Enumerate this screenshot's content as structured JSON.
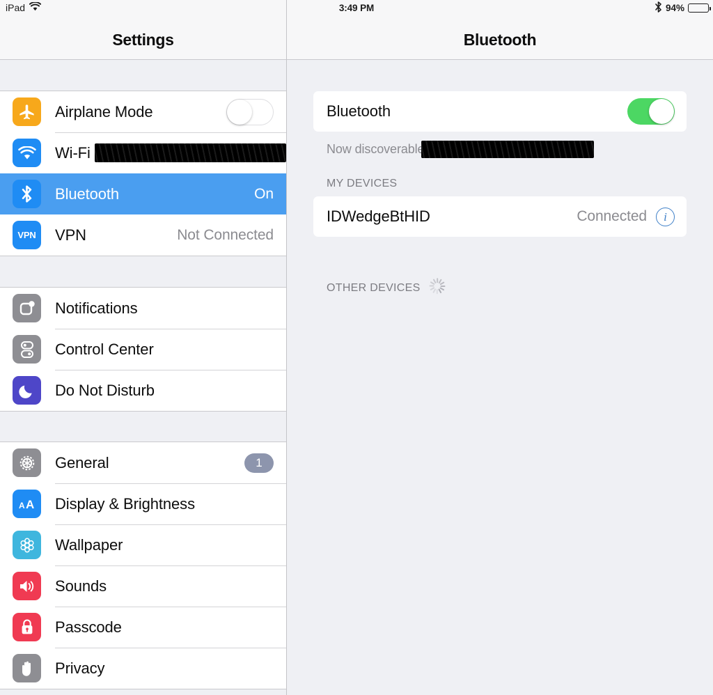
{
  "status_bar": {
    "device_label": "iPad",
    "wifi_icon": "wifi-icon",
    "time": "3:49 PM",
    "bluetooth_icon": "bluetooth-icon",
    "battery_percent": "94%",
    "battery_icon": "battery-full-icon"
  },
  "sidebar": {
    "title": "Settings",
    "groups": [
      {
        "items": [
          {
            "label": "Airplane Mode",
            "icon": "airplane-icon",
            "accessory": "toggle",
            "toggle_on": false,
            "value": ""
          },
          {
            "label": "Wi-Fi",
            "icon": "wifi-icon",
            "accessory": "redaction",
            "value": ""
          },
          {
            "label": "Bluetooth",
            "icon": "bluetooth-icon",
            "accessory": "value",
            "value": "On",
            "selected": true
          },
          {
            "label": "VPN",
            "icon": "vpn-icon",
            "accessory": "value",
            "value": "Not Connected"
          }
        ]
      },
      {
        "items": [
          {
            "label": "Notifications",
            "icon": "notifications-icon",
            "accessory": "none",
            "value": ""
          },
          {
            "label": "Control Center",
            "icon": "control-center-icon",
            "accessory": "none",
            "value": ""
          },
          {
            "label": "Do Not Disturb",
            "icon": "moon-icon",
            "accessory": "none",
            "value": ""
          }
        ]
      },
      {
        "items": [
          {
            "label": "General",
            "icon": "gear-icon",
            "accessory": "badge",
            "value": "1"
          },
          {
            "label": "Display & Brightness",
            "icon": "display-brightness-icon",
            "accessory": "none",
            "value": ""
          },
          {
            "label": "Wallpaper",
            "icon": "wallpaper-icon",
            "accessory": "none",
            "value": ""
          },
          {
            "label": "Sounds",
            "icon": "speaker-icon",
            "accessory": "none",
            "value": ""
          },
          {
            "label": "Passcode",
            "icon": "lock-icon",
            "accessory": "none",
            "value": ""
          },
          {
            "label": "Privacy",
            "icon": "hand-icon",
            "accessory": "none",
            "value": ""
          }
        ]
      }
    ]
  },
  "detail": {
    "title": "Bluetooth",
    "bluetooth_row": {
      "label": "Bluetooth",
      "toggle_on": true
    },
    "discoverable_text": "Now discoverable",
    "my_devices": {
      "header": "MY DEVICES",
      "devices": [
        {
          "name": "IDWedgeBtHID",
          "status": "Connected",
          "info_icon": "info-circle-icon"
        }
      ]
    },
    "other_devices": {
      "header": "OTHER DEVICES",
      "spinner_icon": "loading-spinner-icon"
    }
  },
  "colors": {
    "accent_blue": "#4a9ef0",
    "toggle_green": "#4cd763",
    "panel_bg": "#eff0f4",
    "card_bg": "#ffffff",
    "secondary_text": "#8b8b90",
    "info_blue": "#3f80c8",
    "badge_gray": "#8d95ad"
  }
}
